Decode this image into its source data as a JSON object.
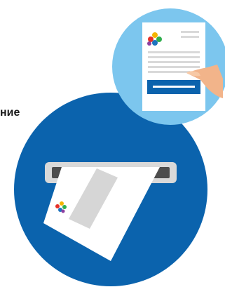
{
  "label_text": "ние",
  "colors": {
    "big_circle": "#0b63ad",
    "small_circle": "#7cc6ee",
    "slot_outer": "#d9d9d9",
    "slot_inner": "#4d4d4d",
    "paper": "#ffffff",
    "paper_gray_panel": "#d6d6d6",
    "doc_lines": "#d9d9d9",
    "doc_button": "#0b63ad",
    "hand": "#f2b48a",
    "logo_red": "#e63027",
    "logo_yellow": "#f4b400",
    "logo_blue": "#1e73be",
    "logo_green": "#2fae4e",
    "logo_purple": "#8d3fa0"
  },
  "icons": {
    "logo": "colorful-flower-logo-icon",
    "hand": "hand-icon",
    "scanner": "scanner-slot-icon"
  }
}
